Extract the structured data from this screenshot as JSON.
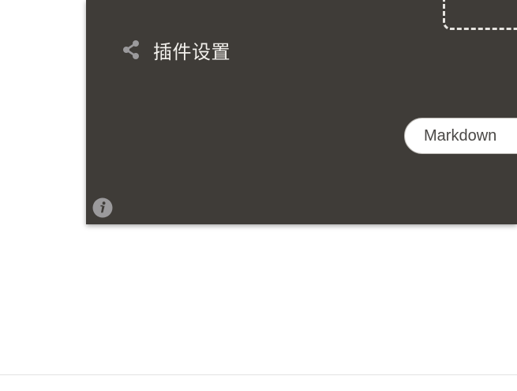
{
  "panel": {
    "settings": {
      "icon": "share-icon",
      "label": "插件设置"
    },
    "markdown_button": {
      "label": "Markdown"
    },
    "info": {
      "icon": "info-icon"
    }
  },
  "colors": {
    "panel_bg": "#3f3c38",
    "icon_gray": "#9b9a9c",
    "label_text": "#f2f0ec"
  }
}
